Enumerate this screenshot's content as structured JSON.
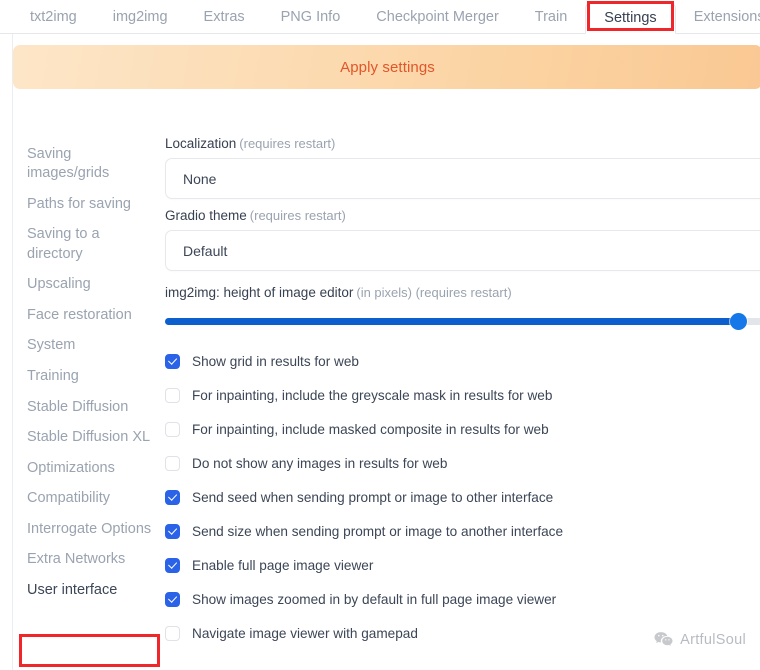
{
  "tabs": [
    {
      "label": "txt2img",
      "active": false
    },
    {
      "label": "img2img",
      "active": false
    },
    {
      "label": "Extras",
      "active": false
    },
    {
      "label": "PNG Info",
      "active": false
    },
    {
      "label": "Checkpoint Merger",
      "active": false
    },
    {
      "label": "Train",
      "active": false
    },
    {
      "label": "Settings",
      "active": true
    },
    {
      "label": "Extensions",
      "active": false
    }
  ],
  "toolbar": {
    "apply_label": "Apply settings"
  },
  "sidebar": {
    "items": [
      {
        "label": "Saving images/grids",
        "active": false
      },
      {
        "label": "Paths for saving",
        "active": false
      },
      {
        "label": "Saving to a directory",
        "active": false
      },
      {
        "label": "Upscaling",
        "active": false
      },
      {
        "label": "Face restoration",
        "active": false
      },
      {
        "label": "System",
        "active": false
      },
      {
        "label": "Training",
        "active": false
      },
      {
        "label": "Stable Diffusion",
        "active": false
      },
      {
        "label": "Stable Diffusion XL",
        "active": false
      },
      {
        "label": "Optimizations",
        "active": false
      },
      {
        "label": "Compatibility",
        "active": false
      },
      {
        "label": "Interrogate Options",
        "active": false
      },
      {
        "label": "Extra Networks",
        "active": false
      },
      {
        "label": "User interface",
        "active": true
      }
    ]
  },
  "main": {
    "localization": {
      "label": "Localization",
      "hint": "(requires restart)",
      "value": "None"
    },
    "gradio_theme": {
      "label": "Gradio theme",
      "hint": "(requires restart)",
      "value": "Default"
    },
    "img2img_height": {
      "label": "img2img: height of image editor",
      "hint": "(in pixels) (requires restart)",
      "fill_percent": 96
    },
    "checkboxes": [
      {
        "label": "Show grid in results for web",
        "checked": true
      },
      {
        "label": "For inpainting, include the greyscale mask in results for web",
        "checked": false
      },
      {
        "label": "For inpainting, include masked composite in results for web",
        "checked": false
      },
      {
        "label": "Do not show any images in results for web",
        "checked": false
      },
      {
        "label": "Send seed when sending prompt or image to other interface",
        "checked": true
      },
      {
        "label": "Send size when sending prompt or image to another interface",
        "checked": true
      },
      {
        "label": "Enable full page image viewer",
        "checked": true
      },
      {
        "label": "Show images zoomed in by default in full page image viewer",
        "checked": true
      },
      {
        "label": "Navigate image viewer with gamepad",
        "checked": false
      }
    ]
  },
  "watermark": {
    "text": "ArtfulSoul",
    "icon": "wechat-icon"
  },
  "annotations": {
    "settings_tab_highlight_color": "#f0272a",
    "user_interface_highlight_color": "#f0272a"
  },
  "colors": {
    "accent_blue": "#2a62e8",
    "slider_blue": "#0d5fce",
    "apply_text": "#e1562a",
    "sidebar_muted": "#9aa3b0",
    "text_primary": "#3c4656"
  }
}
